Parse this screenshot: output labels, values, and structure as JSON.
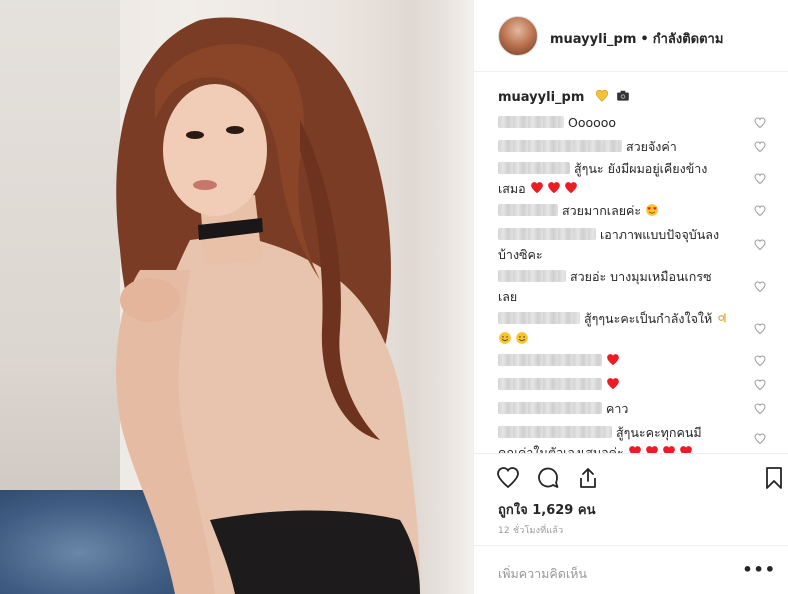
{
  "post": {
    "username": "muayyli_pm",
    "separator": "•",
    "follow_status": "กำลังติดตาม"
  },
  "caption": {
    "username": "muayyli_pm",
    "icons": [
      "yellow-heart-icon",
      "camera-icon"
    ]
  },
  "comments": [
    {
      "text": "Oooooo",
      "line2": ""
    },
    {
      "text": "สวยจังค่า",
      "line2": ""
    },
    {
      "text": "สู้ๆนะ ยังมีผมอยู่เคียงข้าง",
      "line2": "เสมอ"
    },
    {
      "text": "สวยมากเลยค่ะ",
      "line2": ""
    },
    {
      "text": "เอาภาพแบบปัจจุบันลง",
      "line2": "บ้างซิคะ"
    },
    {
      "text": "สวยอ่ะ บางมุมเหมือนเกรซ",
      "line2": "เลย"
    },
    {
      "text": "สู้ๆๆนะคะเป็นกำลังใจให้",
      "line2": ""
    },
    {
      "text": "",
      "line2": ""
    },
    {
      "text": "",
      "line2": ""
    },
    {
      "text": "คาว",
      "line2": ""
    },
    {
      "text": "สู้ๆนะคะทุกคนมี",
      "line2": "คุณค่าในตัวเองเสมอค่ะ"
    }
  ],
  "likes_text": "ถูกใจ 1,629 คน",
  "time_ago": "12 ชั่วโมงที่แล้ว",
  "add_comment_placeholder": "เพิ่มความคิดเห็น",
  "more_label": "•••",
  "colors": {
    "red_heart": "#ed1c24",
    "yellow_heart": "#f5c33b",
    "border": "#efefef",
    "muted": "#999999"
  }
}
